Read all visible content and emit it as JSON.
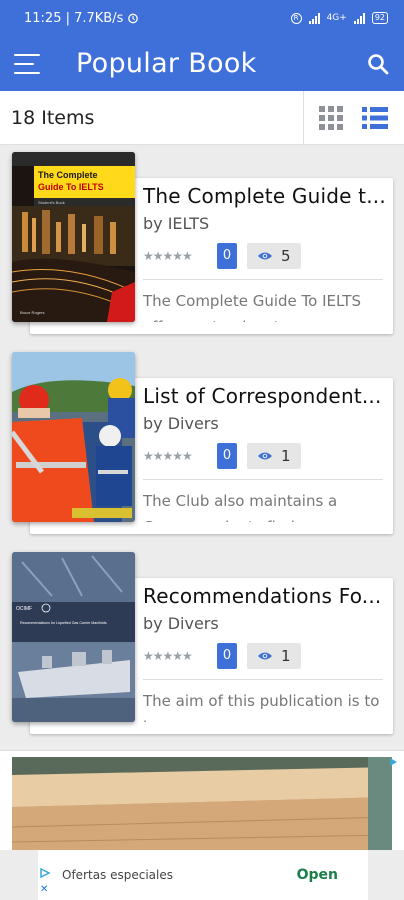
{
  "status_bar": {
    "time_speed": "11:25 | 7.7KB/s",
    "network": "4G+",
    "battery": "92"
  },
  "app_bar": {
    "title": "Popular Book"
  },
  "toolbar": {
    "items_count": "18 Items"
  },
  "books": [
    {
      "title": "The Complete Guide t...",
      "author": "by IELTS",
      "likes": "0",
      "views": "5",
      "description": "The Complete Guide To IELTS offers a step-by-step",
      "cover": {
        "heading_line1": "The Complete",
        "heading_line2": "Guide To IELTS",
        "subtitle": "Student's Book",
        "authors": "Bruce Rogers"
      }
    },
    {
      "title": "List of Correspondent...",
      "author": "by Divers",
      "likes": "0",
      "views": "1",
      "description": "The Club also maintains a Correspondents finder"
    },
    {
      "title": "Recommendations Fo...",
      "author": "by Divers",
      "likes": "0",
      "views": "1",
      "description": "The aim of this publication is to improve",
      "cover": {
        "brand": "OCIMF",
        "heading": "Recommendations for Liquefied Gas Carrier Manifolds"
      }
    }
  ],
  "ad": {
    "text": "Ofertas especiales",
    "cta": "Open"
  },
  "colors": {
    "primary": "#3f6fd8",
    "background": "#ececec"
  }
}
